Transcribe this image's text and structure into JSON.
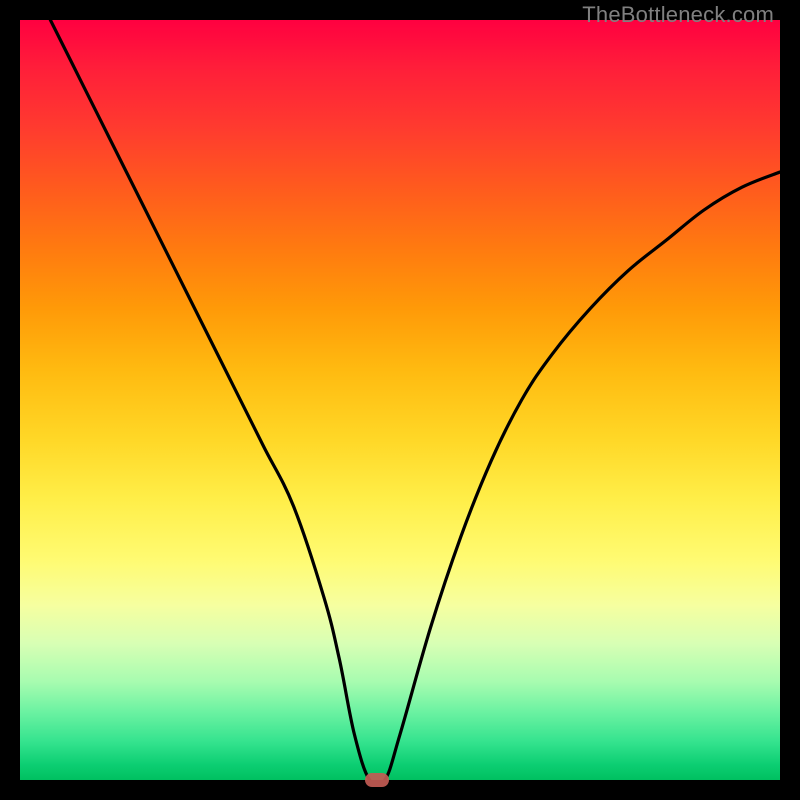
{
  "watermark": "TheBottleneck.com",
  "colors": {
    "curve": "#000000",
    "marker": "#c25b54",
    "frame_bg": "#000000"
  },
  "chart_data": {
    "type": "line",
    "title": "",
    "xlabel": "",
    "ylabel": "",
    "xlim": [
      0,
      100
    ],
    "ylim": [
      0,
      100
    ],
    "grid": false,
    "legend": false,
    "annotations": [
      {
        "text": "TheBottleneck.com",
        "position": "top-right"
      }
    ],
    "series": [
      {
        "name": "bottleneck-curve",
        "x": [
          4,
          8,
          12,
          16,
          20,
          24,
          28,
          32,
          36,
          40,
          42,
          44,
          46,
          48,
          50,
          54,
          58,
          62,
          66,
          70,
          75,
          80,
          85,
          90,
          95,
          100
        ],
        "y": [
          100,
          92,
          84,
          76,
          68,
          60,
          52,
          44,
          36,
          24,
          16,
          6,
          0,
          0,
          6,
          20,
          32,
          42,
          50,
          56,
          62,
          67,
          71,
          75,
          78,
          80
        ]
      }
    ],
    "marker": {
      "x": 47,
      "y": 0,
      "shape": "rounded-rect"
    }
  }
}
